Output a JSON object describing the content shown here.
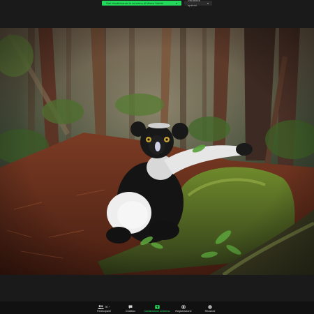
{
  "share_banner": {
    "status_text": "Stai visualizzando lo schermo di Marco Salvini",
    "options_label": "Visualizza opzioni"
  },
  "toolbar": {
    "participants_count": "36",
    "items": [
      {
        "id": "participants",
        "label": "Partecipanti",
        "icon": "participants-icon"
      },
      {
        "id": "chat",
        "label": "Chatbox",
        "icon": "chat-icon"
      },
      {
        "id": "share",
        "label": "Condivisione schermo",
        "icon": "share-screen-icon"
      },
      {
        "id": "record",
        "label": "Registrazione",
        "icon": "record-icon"
      },
      {
        "id": "reactions",
        "label": "Reazioni",
        "icon": "reactions-icon"
      }
    ]
  },
  "colors": {
    "accent": "#23d959",
    "toolbar_bg": "#111111",
    "window_bg": "#1a1a1a"
  }
}
